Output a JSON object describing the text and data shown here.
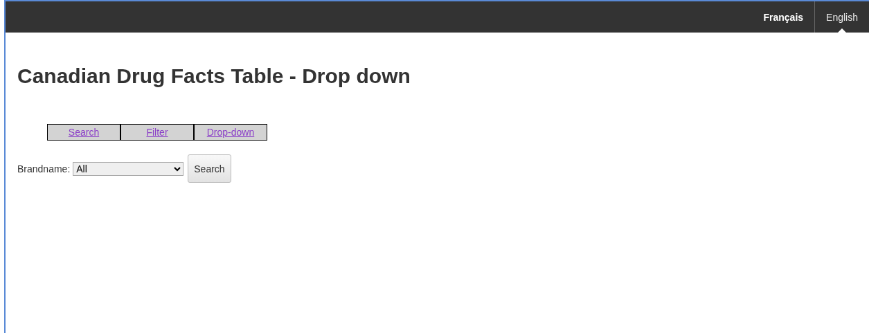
{
  "languages": [
    {
      "label": "Français",
      "selected": false
    },
    {
      "label": "English",
      "selected": true
    }
  ],
  "title": "Canadian Drug Facts Table - Drop down",
  "tabs": [
    {
      "label": "Search"
    },
    {
      "label": "Filter"
    },
    {
      "label": "Drop-down"
    }
  ],
  "form": {
    "label": "Brandname:",
    "select_value": "All",
    "button": "Search"
  }
}
